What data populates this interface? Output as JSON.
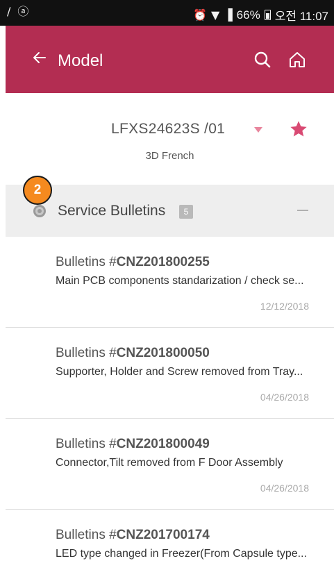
{
  "status_bar": {
    "battery_percent": "66%",
    "time_label": "오전 11:07"
  },
  "appbar": {
    "title": "Model"
  },
  "model": {
    "name": "LFXS24623S /01",
    "type": "3D French"
  },
  "section": {
    "title": "Service Bulletins",
    "count": "5",
    "step_badge": "2"
  },
  "bulletins": [
    {
      "prefix": "Bulletins #",
      "id": "CNZ201800255",
      "title": "Main PCB components standarization / check se...",
      "date": "12/12/2018"
    },
    {
      "prefix": "Bulletins #",
      "id": "CNZ201800050",
      "title": "Supporter, Holder and Screw removed from Tray...",
      "date": "04/26/2018"
    },
    {
      "prefix": "Bulletins #",
      "id": "CNZ201800049",
      "title": "Connector,Tilt removed from F Door Assembly",
      "date": "04/26/2018"
    },
    {
      "prefix": "Bulletins #",
      "id": "CNZ201700174",
      "title": "LED type changed in Freezer(From Capsule type...",
      "date": ""
    }
  ],
  "colors": {
    "appbar": "#b32d52",
    "accent_star": "#d94a73",
    "badge": "#f58a1f"
  }
}
